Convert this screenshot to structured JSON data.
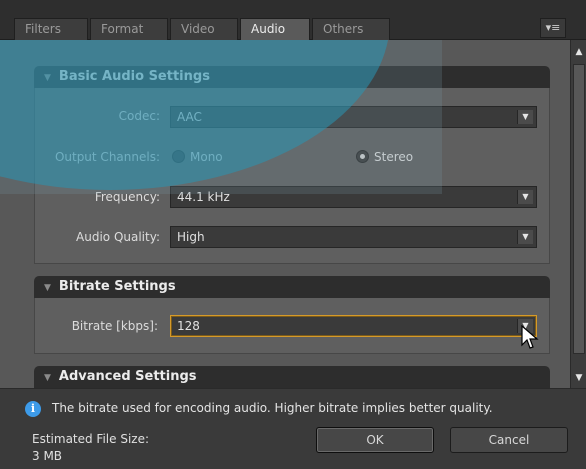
{
  "tabs": [
    {
      "label": "Filters"
    },
    {
      "label": "Format"
    },
    {
      "label": "Video"
    },
    {
      "label": "Audio"
    },
    {
      "label": "Others"
    }
  ],
  "active_tab": "Audio",
  "menu_icon": "menu-list-icon",
  "basic": {
    "title": "Basic Audio Settings",
    "codec_label": "Codec:",
    "codec_value": "AAC",
    "channels_label": "Output Channels:",
    "mono_label": "Mono",
    "stereo_label": "Stereo",
    "selected_channel": "Stereo",
    "frequency_label": "Frequency:",
    "frequency_value": "44.1 kHz",
    "quality_label": "Audio Quality:",
    "quality_value": "High"
  },
  "bitrate": {
    "title": "Bitrate Settings",
    "label": "Bitrate [kbps]:",
    "value": "128"
  },
  "advanced": {
    "title": "Advanced Settings"
  },
  "footer": {
    "info_text": "The bitrate used for encoding audio. Higher bitrate implies better quality.",
    "est_label": "Estimated File Size:",
    "est_value": "3 MB",
    "ok_label": "OK",
    "cancel_label": "Cancel"
  },
  "colors": {
    "accent_focus": "#d59a2a",
    "info_icon": "#3d9be9",
    "overlay": "#2896b4"
  }
}
